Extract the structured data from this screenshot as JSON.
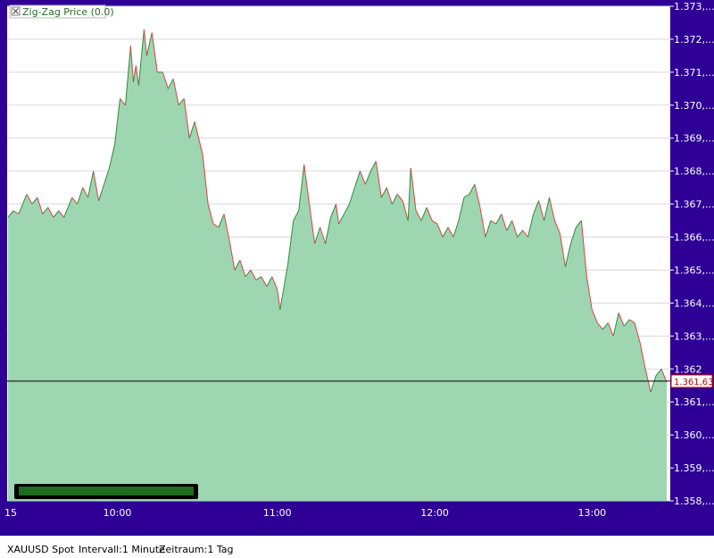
{
  "status": {
    "symbol": "XAUUSD Spot",
    "interval": "Intervall:1 Minute",
    "period": "Zeitraum:1 Tag"
  },
  "chart_data": {
    "type": "area",
    "title": "",
    "legend": {
      "text": "Zig-Zag Price (0.0)",
      "placement": "top-left"
    },
    "xlabel": "",
    "ylabel": "",
    "ylim": [
      1.358,
      1.373
    ],
    "y_ticks": [
      {
        "value": 1.358,
        "label": "1.358,..."
      },
      {
        "value": 1.359,
        "label": "1.359,..."
      },
      {
        "value": 1.36,
        "label": "1.360,..."
      },
      {
        "value": 1.361,
        "label": "1.361,..."
      },
      {
        "value": 1.362,
        "label": "1.362"
      },
      {
        "value": 1.363,
        "label": "1.363,..."
      },
      {
        "value": 1.364,
        "label": "1.364,..."
      },
      {
        "value": 1.365,
        "label": "1.365,..."
      },
      {
        "value": 1.366,
        "label": "1.366,..."
      },
      {
        "value": 1.367,
        "label": "1.367,..."
      },
      {
        "value": 1.368,
        "label": "1.368,..."
      },
      {
        "value": 1.369,
        "label": "1.369,..."
      },
      {
        "value": 1.37,
        "label": "1.370,..."
      },
      {
        "value": 1.371,
        "label": "1.371,..."
      },
      {
        "value": 1.372,
        "label": "1.372,..."
      },
      {
        "value": 1.373,
        "label": "1.373,..."
      }
    ],
    "xlim": [
      0,
      247
    ],
    "x_ticks": [
      {
        "x": 0,
        "label": "15"
      },
      {
        "x": 41,
        "label": "10:00"
      },
      {
        "x": 101,
        "label": "11:00"
      },
      {
        "x": 160,
        "label": "12:00"
      },
      {
        "x": 219,
        "label": "13:00"
      }
    ],
    "current_value": {
      "value": 1.36163,
      "label": "1.361,63"
    },
    "grid": true,
    "colors": {
      "frame": "#2e0096",
      "area_fill": "#9dd6b0",
      "up_line": "#2e8b3a",
      "down_line": "#e04040",
      "current_line": "#000000",
      "current_label": "#c00000",
      "gridline": "#d8d8d8"
    },
    "series": [
      {
        "values": [
          [
            0,
            1.3666
          ],
          [
            2,
            1.3668
          ],
          [
            4,
            1.3667
          ],
          [
            7,
            1.3673
          ],
          [
            9,
            1.367
          ],
          [
            11,
            1.3672
          ],
          [
            13,
            1.3667
          ],
          [
            15,
            1.3669
          ],
          [
            17,
            1.3666
          ],
          [
            19,
            1.3668
          ],
          [
            21,
            1.3666
          ],
          [
            24,
            1.3672
          ],
          [
            26,
            1.367
          ],
          [
            28,
            1.3675
          ],
          [
            30,
            1.3672
          ],
          [
            32,
            1.368
          ],
          [
            34,
            1.3671
          ],
          [
            38,
            1.3681
          ],
          [
            40,
            1.3688
          ],
          [
            42,
            1.3702
          ],
          [
            44,
            1.37
          ],
          [
            46,
            1.3718
          ],
          [
            47,
            1.3707
          ],
          [
            48,
            1.3712
          ],
          [
            49,
            1.3706
          ],
          [
            51,
            1.3723
          ],
          [
            52,
            1.3715
          ],
          [
            54,
            1.3722
          ],
          [
            56,
            1.371
          ],
          [
            58,
            1.371
          ],
          [
            60,
            1.3705
          ],
          [
            62,
            1.3708
          ],
          [
            64,
            1.37
          ],
          [
            66,
            1.3702
          ],
          [
            68,
            1.369
          ],
          [
            70,
            1.3695
          ],
          [
            73,
            1.3685
          ],
          [
            75,
            1.367
          ],
          [
            77,
            1.3664
          ],
          [
            79,
            1.3663
          ],
          [
            81,
            1.3667
          ],
          [
            83,
            1.3659
          ],
          [
            85,
            1.365
          ],
          [
            87,
            1.3653
          ],
          [
            89,
            1.3648
          ],
          [
            91,
            1.365
          ],
          [
            93,
            1.3647
          ],
          [
            95,
            1.3648
          ],
          [
            97,
            1.3645
          ],
          [
            99,
            1.3648
          ],
          [
            101,
            1.3644
          ],
          [
            102,
            1.3638
          ],
          [
            105,
            1.3652
          ],
          [
            107,
            1.3665
          ],
          [
            109,
            1.3668
          ],
          [
            111,
            1.3682
          ],
          [
            113,
            1.367
          ],
          [
            115,
            1.3658
          ],
          [
            117,
            1.3663
          ],
          [
            119,
            1.3658
          ],
          [
            121,
            1.3666
          ],
          [
            123,
            1.367
          ],
          [
            124,
            1.3664
          ],
          [
            126,
            1.3667
          ],
          [
            128,
            1.367
          ],
          [
            130,
            1.3675
          ],
          [
            132,
            1.368
          ],
          [
            134,
            1.3676
          ],
          [
            136,
            1.368
          ],
          [
            138,
            1.3683
          ],
          [
            140,
            1.3672
          ],
          [
            142,
            1.3675
          ],
          [
            144,
            1.367
          ],
          [
            146,
            1.3673
          ],
          [
            148,
            1.3671
          ],
          [
            150,
            1.3665
          ],
          [
            151,
            1.3681
          ],
          [
            153,
            1.3668
          ],
          [
            155,
            1.3665
          ],
          [
            157,
            1.3669
          ],
          [
            159,
            1.3665
          ],
          [
            161,
            1.3664
          ],
          [
            163,
            1.366
          ],
          [
            165,
            1.3663
          ],
          [
            167,
            1.366
          ],
          [
            169,
            1.3665
          ],
          [
            171,
            1.3672
          ],
          [
            173,
            1.3673
          ],
          [
            175,
            1.3676
          ],
          [
            177,
            1.3669
          ],
          [
            179,
            1.366
          ],
          [
            181,
            1.3665
          ],
          [
            183,
            1.3664
          ],
          [
            185,
            1.3667
          ],
          [
            187,
            1.3662
          ],
          [
            189,
            1.3665
          ],
          [
            191,
            1.366
          ],
          [
            193,
            1.3662
          ],
          [
            195,
            1.366
          ],
          [
            197,
            1.3667
          ],
          [
            199,
            1.3671
          ],
          [
            201,
            1.3665
          ],
          [
            203,
            1.3672
          ],
          [
            205,
            1.3665
          ],
          [
            207,
            1.3661
          ],
          [
            209,
            1.3651
          ],
          [
            211,
            1.3658
          ],
          [
            213,
            1.3663
          ],
          [
            215,
            1.3665
          ],
          [
            217,
            1.3648
          ],
          [
            219,
            1.3638
          ],
          [
            221,
            1.3634
          ],
          [
            223,
            1.3632
          ],
          [
            225,
            1.3634
          ],
          [
            227,
            1.363
          ],
          [
            229,
            1.3637
          ],
          [
            231,
            1.3633
          ],
          [
            233,
            1.3635
          ],
          [
            235,
            1.3634
          ],
          [
            237,
            1.3628
          ],
          [
            239,
            1.362
          ],
          [
            241,
            1.3613
          ],
          [
            243,
            1.3618
          ],
          [
            245,
            1.362
          ],
          [
            247,
            1.3616
          ]
        ]
      }
    ]
  }
}
